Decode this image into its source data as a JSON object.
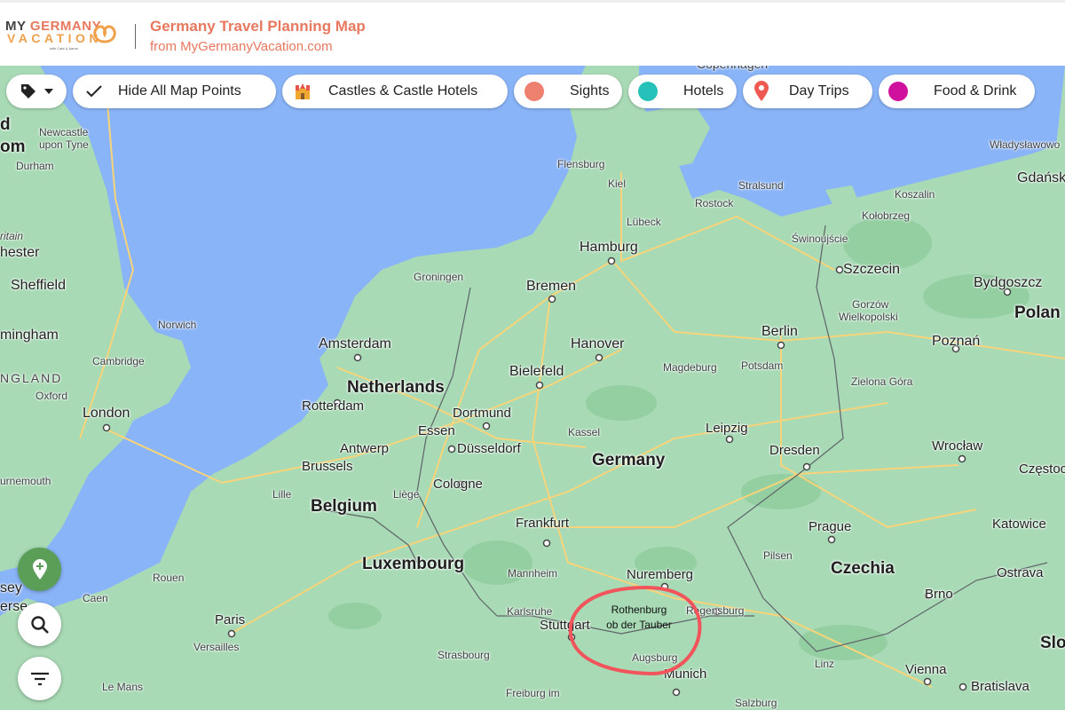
{
  "header": {
    "logo": {
      "line1_a": "MY",
      "line1_b": "GERMANY",
      "line2": "VACATION",
      "tagline": "with Cate & Aaron"
    },
    "title": "Germany Travel Planning Map",
    "subtitle": "from MyGermanyVacation.com"
  },
  "filters": {
    "tag_menu": {
      "icon": "tag-icon",
      "dropdown_icon": "caret-down-icon"
    },
    "chips": [
      {
        "label": "Hide All Map Points",
        "icon": "check-icon"
      },
      {
        "label": "Castles & Castle Hotels",
        "icon": "castle-icon"
      },
      {
        "label": "Sights",
        "icon": "dot",
        "color": "#ee8070"
      },
      {
        "label": "Hotels",
        "icon": "dot",
        "color": "#26c2b9"
      },
      {
        "label": "Day Trips",
        "icon": "map-pin-icon",
        "color": "#ee5a52"
      },
      {
        "label": "Food & Drink",
        "icon": "dot",
        "color": "#d0119e"
      }
    ]
  },
  "controls": {
    "add_place": {
      "icon": "add-location-icon",
      "color": "#5a9e58"
    },
    "search": {
      "icon": "search-icon"
    },
    "filter": {
      "icon": "filter-icon"
    }
  },
  "annotation": {
    "line1": "Rothenburg",
    "line2": "ob der Tauber",
    "circle_color": "#f2545b"
  },
  "map": {
    "colors": {
      "water": "#8ab4f8",
      "land": "#a8dab5",
      "road": "#f7d47a",
      "border": "#5f6368"
    },
    "labels": {
      "countries": [
        "Netherlands",
        "Belgium",
        "Luxembourg",
        "Germany",
        "Czechia",
        "Polan",
        "Slo",
        "d",
        "om"
      ],
      "regions": [
        "NGLAND",
        "ritain"
      ],
      "cities": [
        "Copenhagen",
        "Newcastle",
        "upon Tyne",
        "Durham",
        "hester",
        "Sheffield",
        "Norwich",
        "mingham",
        "Cambridge",
        "Oxford",
        "London",
        "Flensburg",
        "Kiel",
        "Lübeck",
        "Hamburg",
        "Rostock",
        "Stralsund",
        "Świnoujście",
        "Kołobrzeg",
        "Koszalin",
        "Władysławowo",
        "Gdańsk",
        "Szczecin",
        "Bydgoszcz",
        "Gorzów",
        "Wielkopolski",
        "Poznań",
        "Groningen",
        "Bremen",
        "Amsterdam",
        "Hanover",
        "Berlin",
        "Potsdam",
        "Magdeburg",
        "Bielefeld",
        "Rotterdam",
        "Zielona Góra",
        "Dortmund",
        "Essen",
        "Düsseldorf",
        "Kassel",
        "Leipzig",
        "Antwerp",
        "Brussels",
        "Cologne",
        "Dresden",
        "Wrocław",
        "Lille",
        "Liège",
        "Frankfurt",
        "Prague",
        "Katowice",
        "Częstochowa",
        "Mannheim",
        "Nuremberg",
        "Pilsen",
        "Ostrava",
        "Rouen",
        "Karlsruhe",
        "Stuttgart",
        "Regensburg",
        "Brno",
        "Caen",
        "Paris",
        "Versailles",
        "Strasbourg",
        "Augsburg",
        "Munich",
        "Linz",
        "Vienna",
        "Bratislava",
        "Le Mans",
        "Freiburg im",
        "Salzburg",
        "urnemouth",
        "sey",
        "erse"
      ]
    }
  }
}
